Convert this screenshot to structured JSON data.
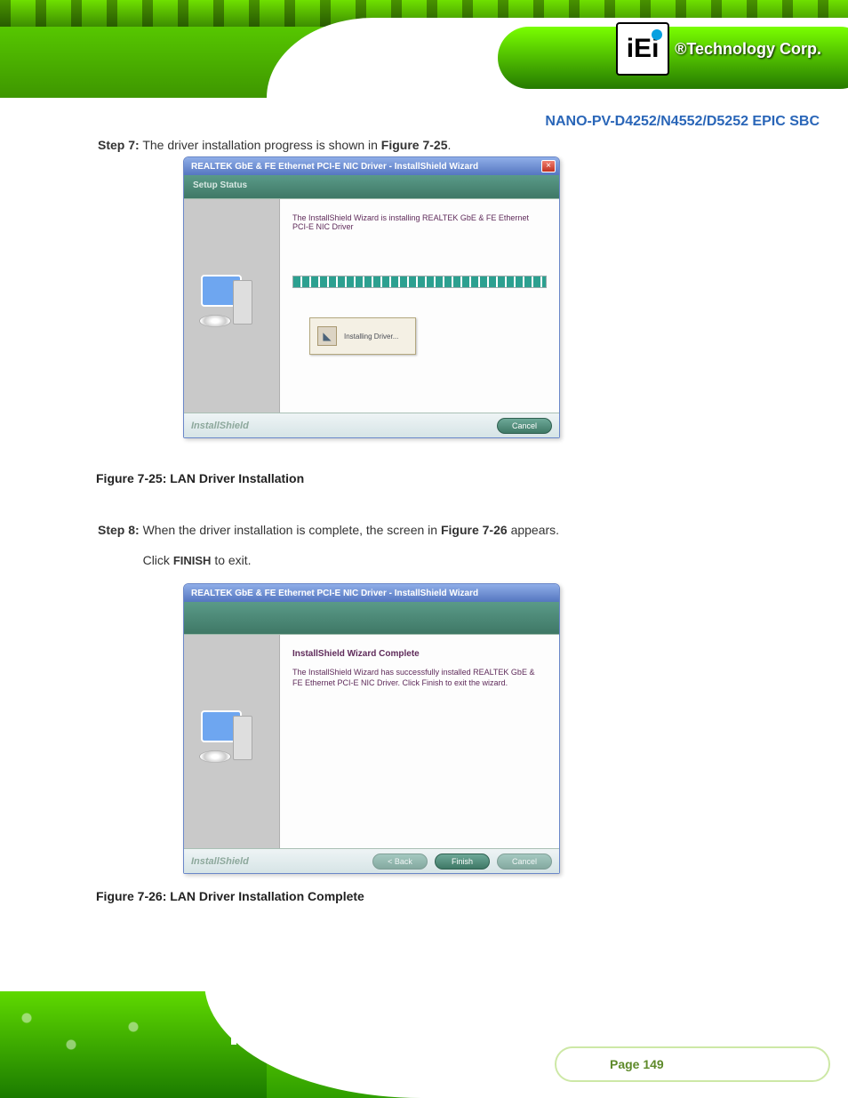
{
  "header": {
    "brand": "iEi",
    "tagline": "®Technology Corp.",
    "doc_title": "NANO-PV-D4252/N4552/D5252 EPIC SBC"
  },
  "step7": {
    "prefix": "Step 7:",
    "body": "The driver installation progress is shown in ",
    "ref": "Figure 7-25",
    "suffix": "."
  },
  "installer1": {
    "title": "REALTEK GbE & FE Ethernet PCI-E NIC Driver - InstallShield Wizard",
    "sub": "Setup Status",
    "msg": "The InstallShield Wizard is installing REALTEK GbE & FE Ethernet PCI-E NIC Driver",
    "popup": "Installing Driver...",
    "brand": "InstallShield",
    "cancel": "Cancel"
  },
  "caption1": "Figure 7-25: LAN Driver Installation",
  "step8": {
    "prefix": "Step 8:",
    "body1": "When the driver installation is complete, the screen in ",
    "ref": "Figure 7-26",
    "body2": " appears.",
    "body3": "Click ",
    "finish": "Finish",
    "body4": " to exit."
  },
  "installer2": {
    "title": "REALTEK GbE & FE Ethernet PCI-E NIC Driver - InstallShield Wizard",
    "heading": "InstallShield Wizard Complete",
    "msg": "The InstallShield Wizard has successfully installed REALTEK GbE & FE Ethernet PCI-E NIC Driver. Click Finish to exit the wizard.",
    "brand": "InstallShield",
    "back": "< Back",
    "finish": "Finish",
    "cancel": "Cancel"
  },
  "caption2": "Figure 7-26: LAN Driver Installation Complete",
  "footer": {
    "page": "Page 149"
  }
}
